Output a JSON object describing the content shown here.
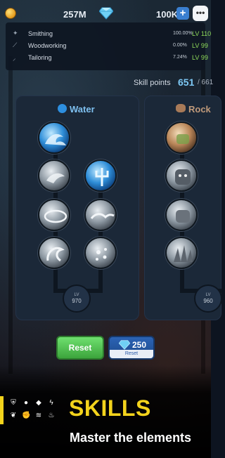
{
  "topbar": {
    "gold": "257M",
    "gems": "100K",
    "plus_label": "+",
    "chat_label": "•••",
    "icons": [
      "coin-icon",
      "gem-icon",
      "plus-icon",
      "chat-icon"
    ],
    "colors": {
      "gold": "#f0b22a",
      "gem": "#6fd0f5",
      "plus": "#3a7fd0"
    }
  },
  "skills_list": {
    "rows": [
      {
        "name": "Smithing",
        "percent": "100.00%",
        "level": "LV 110",
        "icon": "anvil-icon"
      },
      {
        "name": "Woodworking",
        "percent": "0.00%",
        "level": "LV 99",
        "icon": "saw-icon"
      },
      {
        "name": "Tailoring",
        "percent": "7.24%",
        "level": "LV 99",
        "icon": "needle-icon"
      }
    ]
  },
  "skill_points": {
    "label": "Skill points",
    "value": "651",
    "total": "/ 661"
  },
  "trees": [
    {
      "name": "Water",
      "icon": "water-drop-icon",
      "level_label": "LV",
      "level_value": "970",
      "nodes": [
        "water-wave-node",
        "water-splash-node",
        "water-trident-node",
        "water-vortex-node",
        "water-tide-node",
        "water-serpent-node",
        "water-mist-node"
      ]
    },
    {
      "name": "Rock",
      "icon": "rock-icon",
      "level_label": "LV",
      "level_value": "960",
      "nodes": [
        "rock-punch-node",
        "rock-golem-node",
        "rock-fist-node",
        "rock-spikes-node"
      ]
    }
  ],
  "buttons": {
    "reset_label": "Reset",
    "gem_reset_amount": "250",
    "gem_reset_label": "Reset"
  },
  "promo": {
    "title": "SKILLS",
    "subtitle": "Master the elements",
    "accent": "#f3d31c",
    "element_icons": [
      "shield-icon",
      "water-drop-icon",
      "rock-icon",
      "lightning-icon",
      "leaf-icon",
      "fire-icon"
    ]
  }
}
